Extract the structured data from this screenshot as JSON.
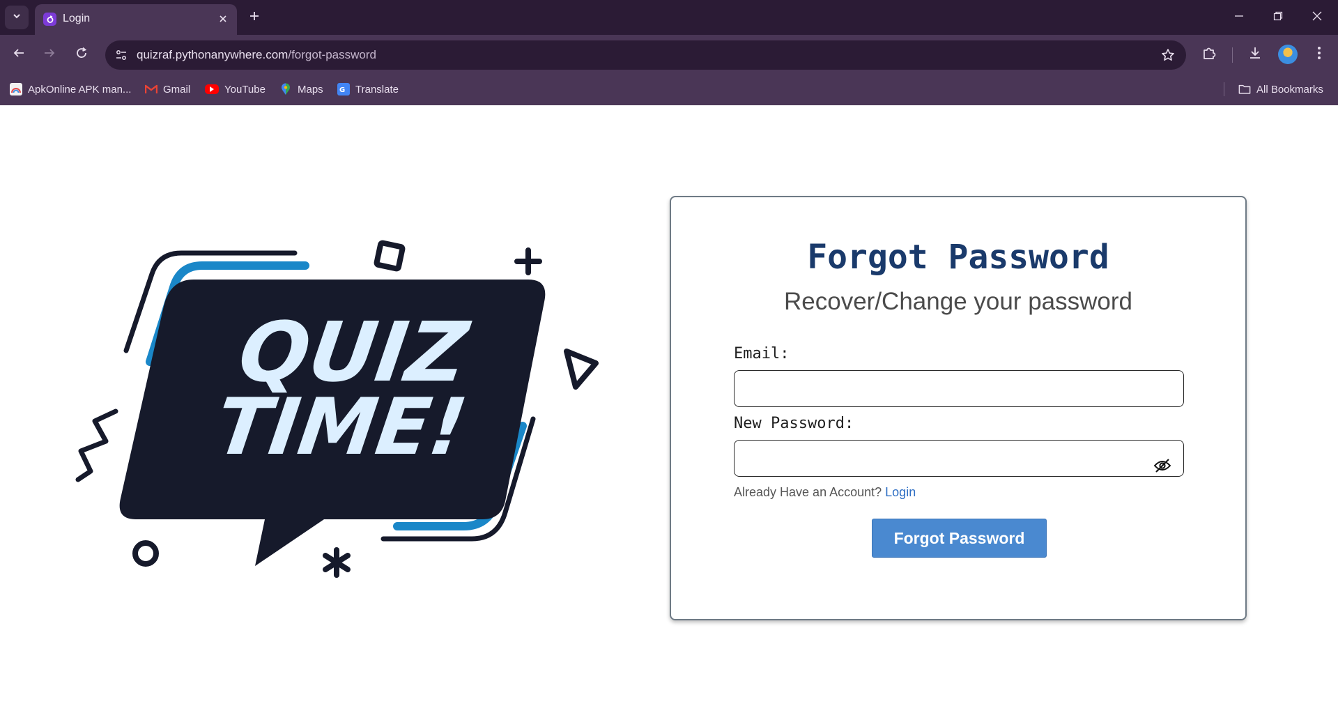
{
  "browser": {
    "tab": {
      "title": "Login"
    },
    "address": {
      "host": "quizraf.pythonanywhere.com",
      "path": "/forgot-password"
    },
    "bookmarks": [
      {
        "label": "ApkOnline APK man..."
      },
      {
        "label": "Gmail"
      },
      {
        "label": "YouTube"
      },
      {
        "label": "Maps"
      },
      {
        "label": "Translate"
      }
    ],
    "all_bookmarks_label": "All Bookmarks"
  },
  "illustration": {
    "line1": "QUIZ",
    "line2": "TIME!"
  },
  "form": {
    "title": "Forgot Password",
    "subtitle": "Recover/Change your password",
    "email_label": "Email:",
    "email_value": "",
    "password_label": "New Password:",
    "password_value": "",
    "account_prompt": "Already Have an Account?",
    "login_link": "Login",
    "submit_label": "Forgot Password"
  },
  "colors": {
    "brand_title": "#1a3a6b",
    "button": "#4a89d0",
    "link": "#2f6fc4",
    "chrome_dark": "#2b1b35",
    "chrome_mid": "#4a3656",
    "quiz_bubble": "#161a2b",
    "quiz_text": "#dcefff",
    "quiz_accent": "#1a87c8"
  }
}
